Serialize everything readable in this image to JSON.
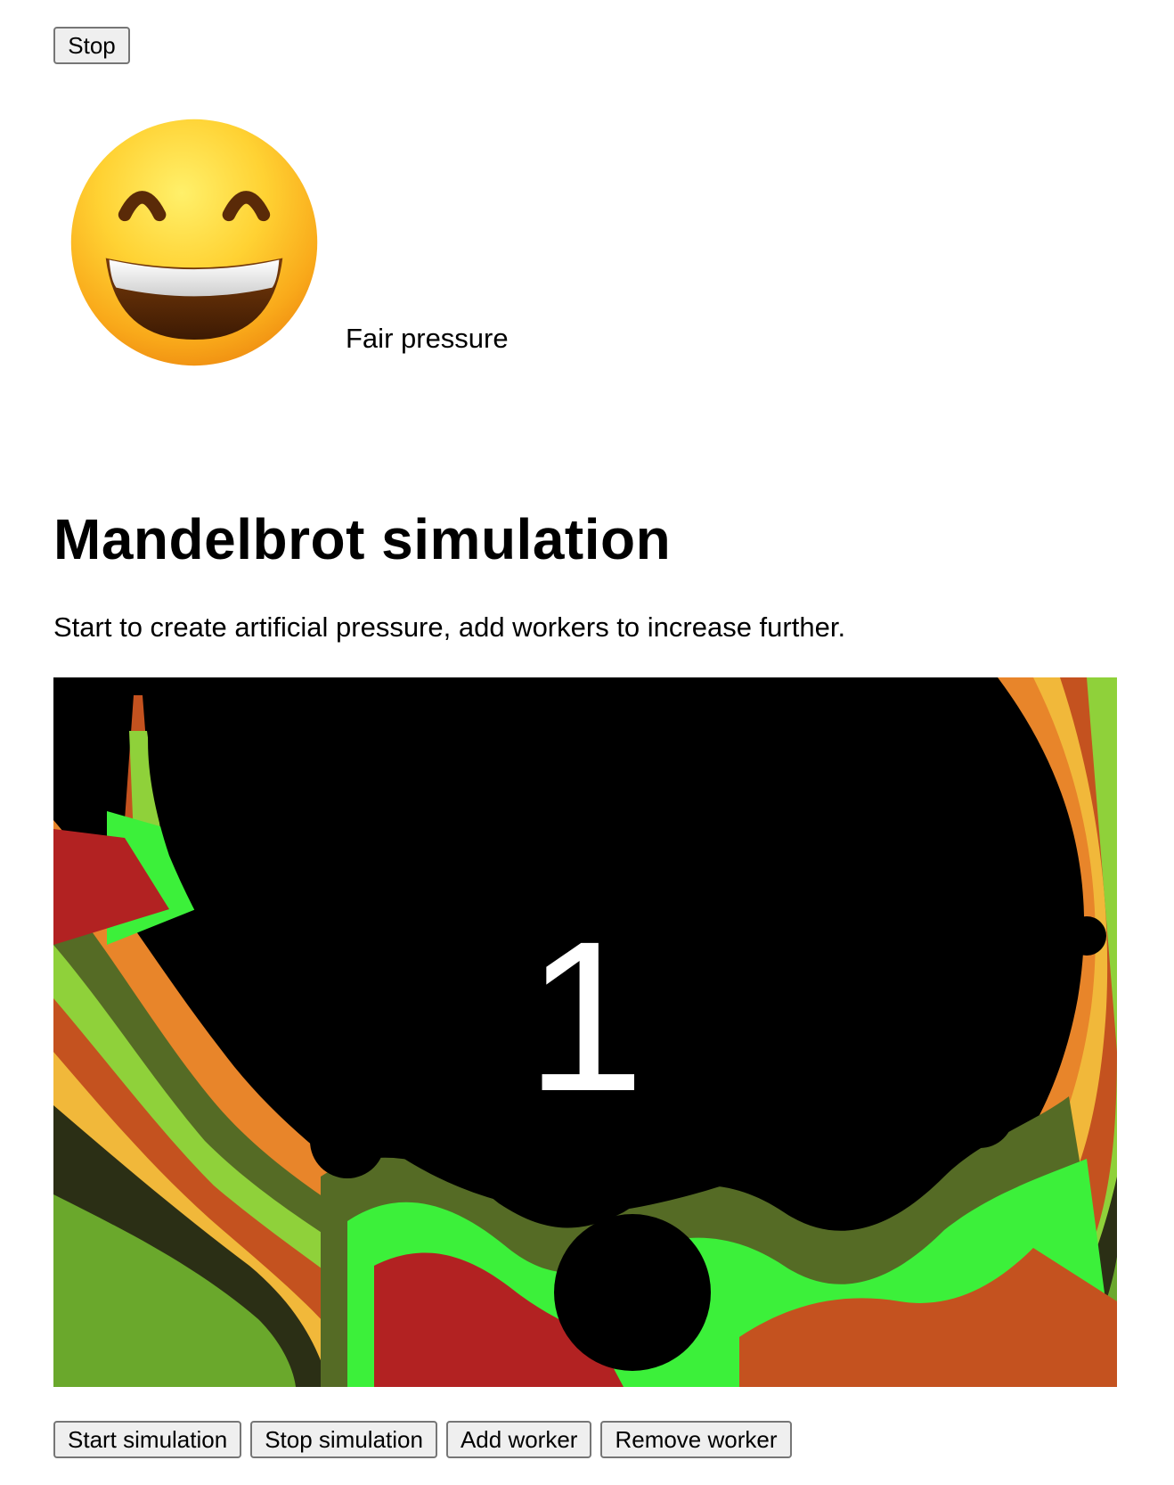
{
  "top_controls": {
    "stop_label": "Stop"
  },
  "pressure": {
    "emoji_icon": "grinning-face-with-smiling-eyes",
    "status_text": "Fair pressure"
  },
  "main": {
    "title": "Mandelbrot simulation",
    "description": "Start to create artificial pressure, add workers to increase further.",
    "counter": "1"
  },
  "controls": {
    "start_label": "Start simulation",
    "stop_label": "Stop simulation",
    "add_label": "Add worker",
    "remove_label": "Remove worker"
  },
  "palette": {
    "background": "#000000",
    "bands": [
      "#6aa82c",
      "#2b2f15",
      "#f1b83a",
      "#c4521f",
      "#8fd13a",
      "#3cf03a",
      "#556b25",
      "#b22222",
      "#e8852a"
    ]
  }
}
